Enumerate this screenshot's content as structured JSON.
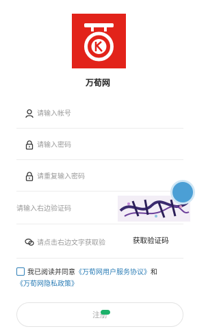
{
  "app": {
    "name": "万荀网"
  },
  "form": {
    "account_placeholder": "请输入帐号",
    "password_placeholder": "请输入密码",
    "confirm_placeholder": "请重复输入密码",
    "captcha_placeholder": "请输入右边验证码",
    "sms_placeholder": "请点击右边文字获取验",
    "sms_button": "获取验证码"
  },
  "agreement": {
    "prefix": "我已阅读并同意",
    "user_agreement": "《万荀网用户服务协议》",
    "and": "和",
    "privacy_policy": "《万荀网隐私政策》"
  },
  "register_button": "注册",
  "colors": {
    "brand": "#e2231a",
    "link": "#2f7fb7",
    "accent_green": "#1db16a"
  }
}
